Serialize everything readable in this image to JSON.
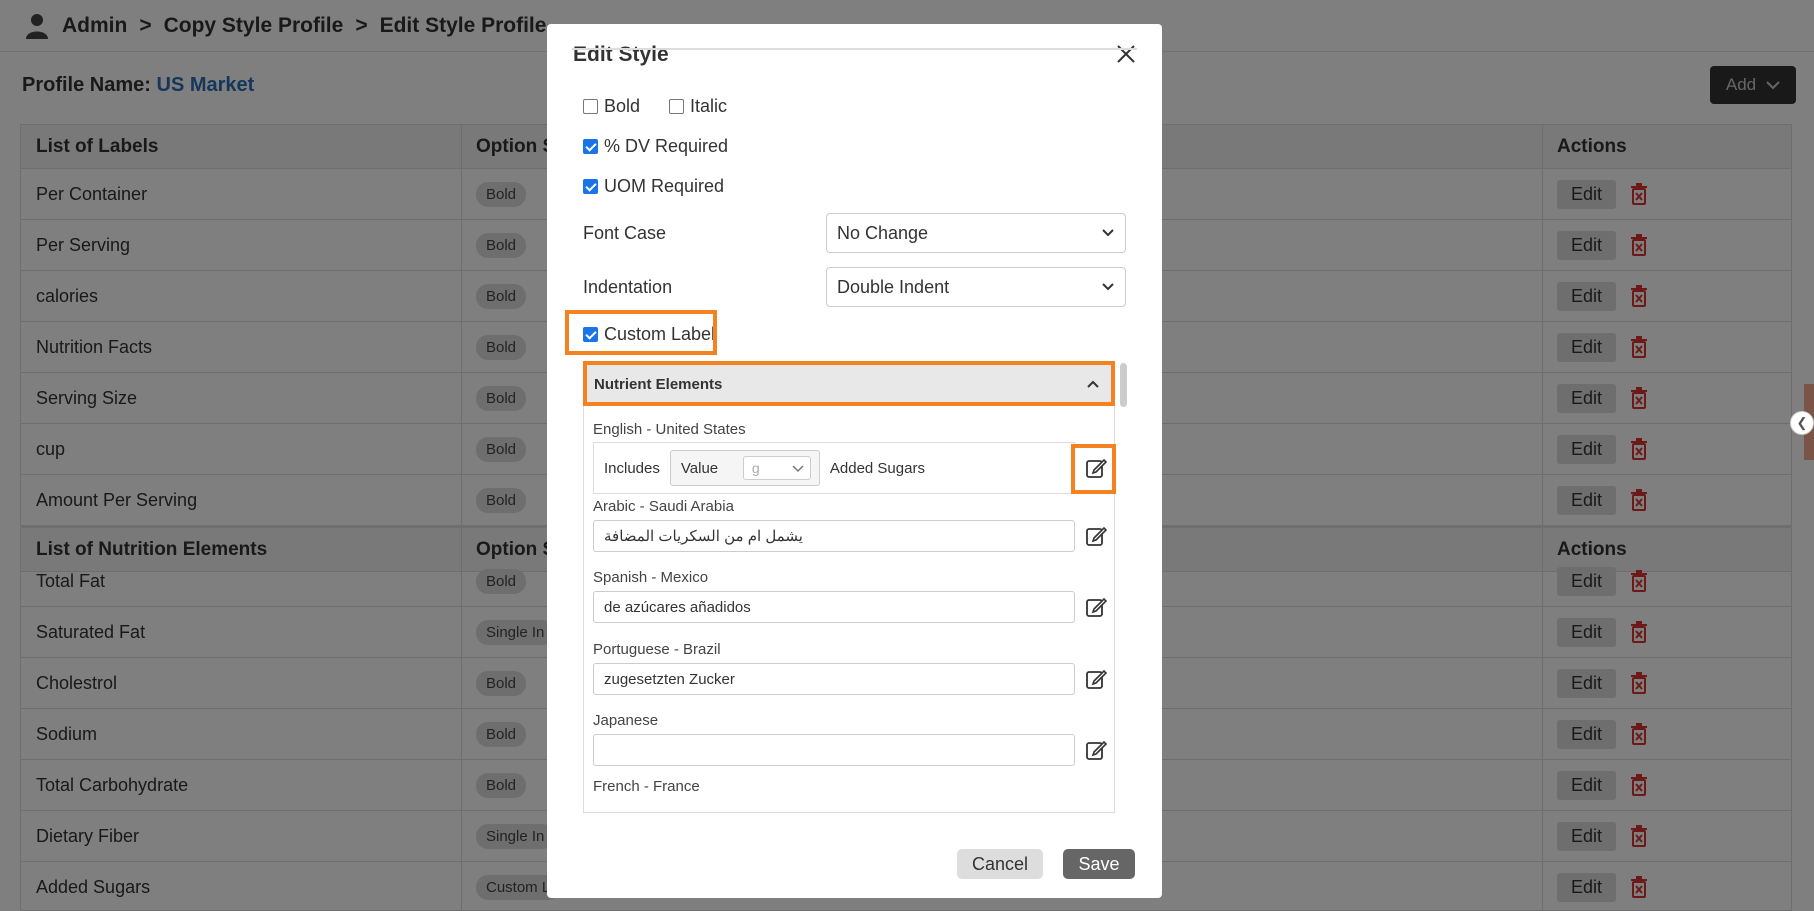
{
  "breadcrumb": {
    "items": [
      "Admin",
      "Copy Style Profile",
      "Edit Style Profile"
    ],
    "sep": ">"
  },
  "profile": {
    "label": "Profile Name:",
    "value": "US Market"
  },
  "add_button": "Add",
  "labels_table": {
    "headers": [
      "List of Labels",
      "Option S",
      "Actions"
    ],
    "rows": [
      {
        "name": "Per Container",
        "option": "Bold"
      },
      {
        "name": "Per Serving",
        "option": "Bold"
      },
      {
        "name": "calories",
        "option": "Bold"
      },
      {
        "name": "Nutrition Facts",
        "option": "Bold"
      },
      {
        "name": "Serving Size",
        "option": "Bold"
      },
      {
        "name": "cup",
        "option": "Bold"
      },
      {
        "name": "Amount Per Serving",
        "option": "Bold"
      }
    ]
  },
  "nutrition_table": {
    "headers": [
      "List of Nutrition Elements",
      "Option S",
      "Actions"
    ],
    "rows": [
      {
        "name": "Total Fat",
        "option": "Bold"
      },
      {
        "name": "Saturated Fat",
        "option": "Single In"
      },
      {
        "name": "Cholestrol",
        "option": "Bold"
      },
      {
        "name": "Sodium",
        "option": "Bold"
      },
      {
        "name": "Total Carbohydrate",
        "option": "Bold"
      },
      {
        "name": "Dietary Fiber",
        "option": "Single In"
      },
      {
        "name": "Added Sugars",
        "option": "Custom L"
      }
    ]
  },
  "row_actions": {
    "edit": "Edit"
  },
  "modal": {
    "title": "Edit Style",
    "bold": "Bold",
    "italic": "Italic",
    "dv_required": "% DV Required",
    "uom_required": "UOM Required",
    "font_case_label": "Font Case",
    "font_case_value": "No Change",
    "indentation_label": "Indentation",
    "indentation_value": "Double Indent",
    "custom_label": "Custom Label",
    "accordion_title": "Nutrient Elements",
    "english": {
      "lang": "English - United States",
      "includes": "Includes",
      "value": "Value",
      "unit": "g",
      "suffix": "Added Sugars"
    },
    "translations": [
      {
        "lang": "Arabic - Saudi Arabia",
        "text": "يشمل ام من السكريات المضافة"
      },
      {
        "lang": "Spanish - Mexico",
        "text": "de azúcares añadidos"
      },
      {
        "lang": "Portuguese - Brazil",
        "text": "zugesetzten Zucker"
      },
      {
        "lang": "Japanese",
        "text": ""
      },
      {
        "lang": "French - France",
        "text": ""
      }
    ],
    "cancel": "Cancel",
    "save": "Save"
  },
  "colors": {
    "accent_orange": "#f58220",
    "checkbox_blue": "#1a73e8",
    "link_blue": "#2a6fb5"
  }
}
